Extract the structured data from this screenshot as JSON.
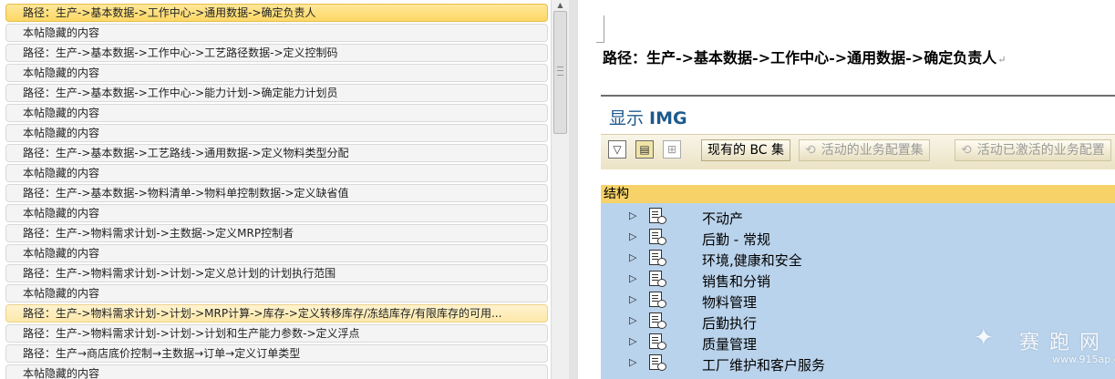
{
  "list": [
    {
      "text": "路径：生产->基本数据->工作中心->通用数据->确定负责人",
      "style": "hl"
    },
    {
      "text": "本帖隐藏的内容",
      "style": ""
    },
    {
      "text": "路径：生产->基本数据->工作中心->工艺路径数据->定义控制码",
      "style": ""
    },
    {
      "text": "本帖隐藏的内容",
      "style": ""
    },
    {
      "text": "路径：生产->基本数据->工作中心->能力计划->确定能力计划员",
      "style": ""
    },
    {
      "text": "本帖隐藏的内容",
      "style": ""
    },
    {
      "text": "本帖隐藏的内容",
      "style": ""
    },
    {
      "text": "路径：生产->基本数据->工艺路线->通用数据->定义物料类型分配",
      "style": ""
    },
    {
      "text": "本帖隐藏的内容",
      "style": ""
    },
    {
      "text": "路径：生产->基本数据->物料清单->物料单控制数据->定义缺省值",
      "style": ""
    },
    {
      "text": "本帖隐藏的内容",
      "style": ""
    },
    {
      "text": "路径：生产->物料需求计划->主数据->定义MRP控制者",
      "style": ""
    },
    {
      "text": "本帖隐藏的内容",
      "style": ""
    },
    {
      "text": "路径：生产->物料需求计划->计划->定义总计划的计划执行范围",
      "style": ""
    },
    {
      "text": "本帖隐藏的内容",
      "style": ""
    },
    {
      "text": "路径：生产->物料需求计划->计划->MRP计算->库存->定义转移库存/冻结库存/有限库存的可用...",
      "style": "hl2"
    },
    {
      "text": "路径：生产->物料需求计划->计划->计划和生产能力参数->定义浮点",
      "style": ""
    },
    {
      "text": "路径：生产→商店底价控制→主数据→订单→定义订单类型",
      "style": ""
    },
    {
      "text": "本帖隐藏的内容",
      "style": ""
    }
  ],
  "doc": {
    "title": "路径：生产->基本数据->工作中心->通用数据->确定负责人",
    "para_mark": "↵",
    "img_title_prefix": "显示 ",
    "img_title_bold": "IMG",
    "toolbar": {
      "btn_current_bc": "现有的 BC 集",
      "btn_active_sets": "活动的业务配置集",
      "btn_activated_sets": "活动已激活的业务配置"
    },
    "structure_header": "结构",
    "tree": [
      "不动产",
      "后勤 - 常规",
      "环境,健康和安全",
      "销售和分销",
      "物料管理",
      "后勤执行",
      "质量管理",
      "工厂维护和客户服务"
    ]
  },
  "watermark": {
    "logo": "赛",
    "text": "赛 跑 网",
    "url": "www.915ap.com"
  }
}
